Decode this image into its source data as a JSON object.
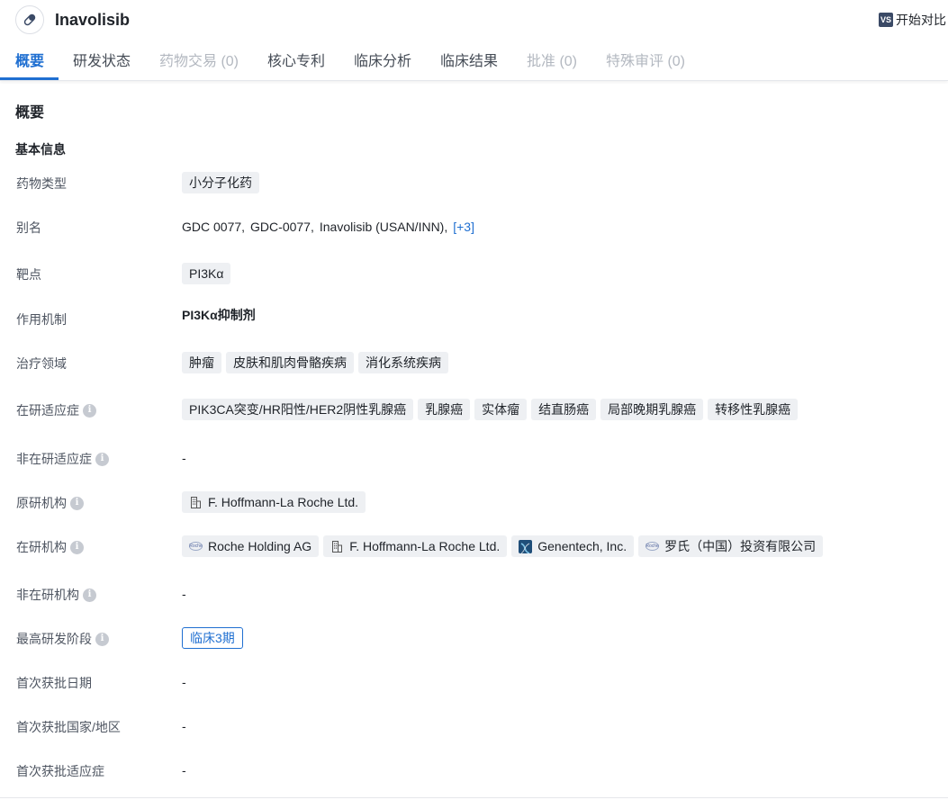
{
  "drug": {
    "name": "Inavolisib",
    "compare_icon_text": "VS",
    "compare_label": "开始对比"
  },
  "tabs": [
    {
      "label": "概要",
      "state": "active"
    },
    {
      "label": "研发状态",
      "state": "normal"
    },
    {
      "label": "药物交易 (0)",
      "state": "disabled"
    },
    {
      "label": "核心专利",
      "state": "normal"
    },
    {
      "label": "临床分析",
      "state": "normal"
    },
    {
      "label": "临床结果",
      "state": "normal"
    },
    {
      "label": "批准 (0)",
      "state": "disabled"
    },
    {
      "label": "特殊审评 (0)",
      "state": "disabled"
    }
  ],
  "overview": {
    "section_title": "概要",
    "basic_info_title": "基本信息",
    "drug_type": {
      "label": "药物类型",
      "tags": [
        "小分子化药"
      ]
    },
    "aliases": {
      "label": "别名",
      "items": [
        "GDC 0077,",
        "GDC-0077,",
        "Inavolisib (USAN/INN),"
      ],
      "more": "[+3]"
    },
    "target": {
      "label": "靶点",
      "tags": [
        "PI3Kα"
      ]
    },
    "mechanism": {
      "label": "作用机制",
      "value": "PI3Kα抑制剂"
    },
    "therapeutic_area": {
      "label": "治疗领域",
      "tags": [
        "肿瘤",
        "皮肤和肌肉骨骼疾病",
        "消化系统疾病"
      ]
    },
    "active_indications": {
      "label": "在研适应症",
      "tags": [
        "PIK3CA突变/HR阳性/HER2阴性乳腺癌",
        "乳腺癌",
        "实体瘤",
        "结直肠癌",
        "局部晚期乳腺癌",
        "转移性乳腺癌"
      ]
    },
    "inactive_indications": {
      "label": "非在研适应症",
      "value": "-"
    },
    "originator": {
      "label": "原研机构",
      "orgs": [
        {
          "name": "F. Hoffmann-La Roche Ltd.",
          "icon": "building-icon"
        }
      ]
    },
    "active_orgs": {
      "label": "在研机构",
      "orgs": [
        {
          "name": "Roche Holding AG",
          "icon": "roche-logo-icon"
        },
        {
          "name": "F. Hoffmann-La Roche Ltd.",
          "icon": "building-icon"
        },
        {
          "name": "Genentech, Inc.",
          "icon": "genentech-logo-icon"
        },
        {
          "name": "罗氏（中国）投资有限公司",
          "icon": "roche-logo-icon"
        }
      ]
    },
    "inactive_orgs": {
      "label": "非在研机构",
      "value": "-"
    },
    "highest_phase": {
      "label": "最高研发阶段",
      "value": "临床3期"
    },
    "first_approval_date": {
      "label": "首次获批日期",
      "value": "-"
    },
    "first_approval_region": {
      "label": "首次获批国家/地区",
      "value": "-"
    },
    "first_approval_indication": {
      "label": "首次获批适应症",
      "value": "-"
    }
  },
  "info_icon_glyph": "i",
  "roche_logo_text": "Roche",
  "colors": {
    "accent": "#1f6fd1",
    "tag_bg": "#eef0f3",
    "disabled": "#b3b8c0"
  }
}
